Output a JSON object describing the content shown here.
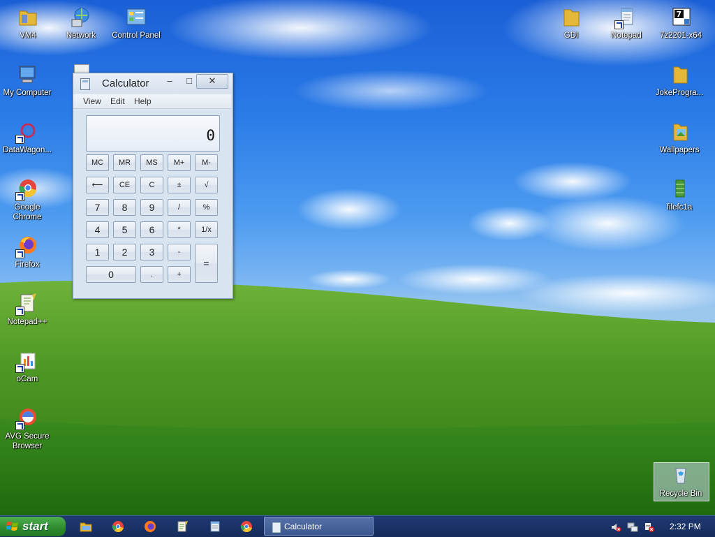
{
  "desktop": {
    "icons_left": [
      {
        "name": "vm4-folder-icon",
        "label": "VM4",
        "type": "folder"
      },
      {
        "name": "network-icon",
        "label": "Network",
        "type": "network"
      },
      {
        "name": "control-panel-icon",
        "label": "Control Panel",
        "type": "controlpanel"
      },
      {
        "name": "my-computer-icon",
        "label": "My Computer",
        "type": "computer"
      },
      {
        "name": "datawagon-icon",
        "label": "DataWagon...",
        "type": "datawagon"
      },
      {
        "name": "chrome-icon",
        "label": "Google Chrome",
        "type": "chrome"
      },
      {
        "name": "firefox-icon",
        "label": "Firefox",
        "type": "firefox"
      },
      {
        "name": "notepadpp-icon",
        "label": "Notepad++",
        "type": "notepadpp"
      },
      {
        "name": "ocam-icon",
        "label": "oCam",
        "type": "ocam"
      },
      {
        "name": "avg-browser-icon",
        "label": "AVG Secure Browser",
        "type": "avg"
      }
    ],
    "icons_right": [
      {
        "name": "gdi-folder-icon",
        "label": "GDI",
        "type": "folder"
      },
      {
        "name": "notepad-icon",
        "label": "Notepad",
        "type": "notepad"
      },
      {
        "name": "7z-icon",
        "label": "7z2201-x64",
        "type": "7z"
      },
      {
        "name": "jokeprogram-folder-icon",
        "label": "JokeProgra...",
        "type": "folder"
      },
      {
        "name": "wallpapers-folder-icon",
        "label": "Wallpapers",
        "type": "folderimg"
      },
      {
        "name": "filefc1a-icon",
        "label": "filefc1a",
        "type": "file"
      },
      {
        "name": "recycle-bin-icon",
        "label": "Recycle Bin",
        "type": "recycle"
      }
    ]
  },
  "calculator": {
    "title": "Calculator",
    "menu": [
      "View",
      "Edit",
      "Help"
    ],
    "display": "0",
    "minimize": "–",
    "maximize": "□",
    "close": "✕",
    "keys": [
      {
        "name": "key-mc",
        "label": "MC"
      },
      {
        "name": "key-mr",
        "label": "MR"
      },
      {
        "name": "key-ms",
        "label": "MS"
      },
      {
        "name": "key-mplus",
        "label": "M+"
      },
      {
        "name": "key-mminus",
        "label": "M-"
      },
      {
        "name": "key-backspace",
        "label": "⟵"
      },
      {
        "name": "key-ce",
        "label": "CE"
      },
      {
        "name": "key-c",
        "label": "C"
      },
      {
        "name": "key-plusminus",
        "label": "±"
      },
      {
        "name": "key-sqrt",
        "label": "√"
      },
      {
        "name": "key-7",
        "label": "7"
      },
      {
        "name": "key-8",
        "label": "8"
      },
      {
        "name": "key-9",
        "label": "9"
      },
      {
        "name": "key-divide",
        "label": "/"
      },
      {
        "name": "key-percent",
        "label": "%"
      },
      {
        "name": "key-4",
        "label": "4"
      },
      {
        "name": "key-5",
        "label": "5"
      },
      {
        "name": "key-6",
        "label": "6"
      },
      {
        "name": "key-multiply",
        "label": "*"
      },
      {
        "name": "key-reciprocal",
        "label": "1/x"
      },
      {
        "name": "key-1",
        "label": "1"
      },
      {
        "name": "key-2",
        "label": "2"
      },
      {
        "name": "key-3",
        "label": "3"
      },
      {
        "name": "key-minus",
        "label": "-"
      },
      {
        "name": "key-equals",
        "label": "="
      },
      {
        "name": "key-0",
        "label": "0"
      },
      {
        "name": "key-decimal",
        "label": "."
      },
      {
        "name": "key-plus",
        "label": "+"
      }
    ]
  },
  "taskbar": {
    "start_label": "start",
    "quick_launch": [
      "explorer-icon",
      "chrome-icon",
      "firefox-icon",
      "notepadpp-icon",
      "notepad-icon",
      "chrome-alt-icon"
    ],
    "task_label": "Calculator",
    "clock": "2:32 PM"
  }
}
